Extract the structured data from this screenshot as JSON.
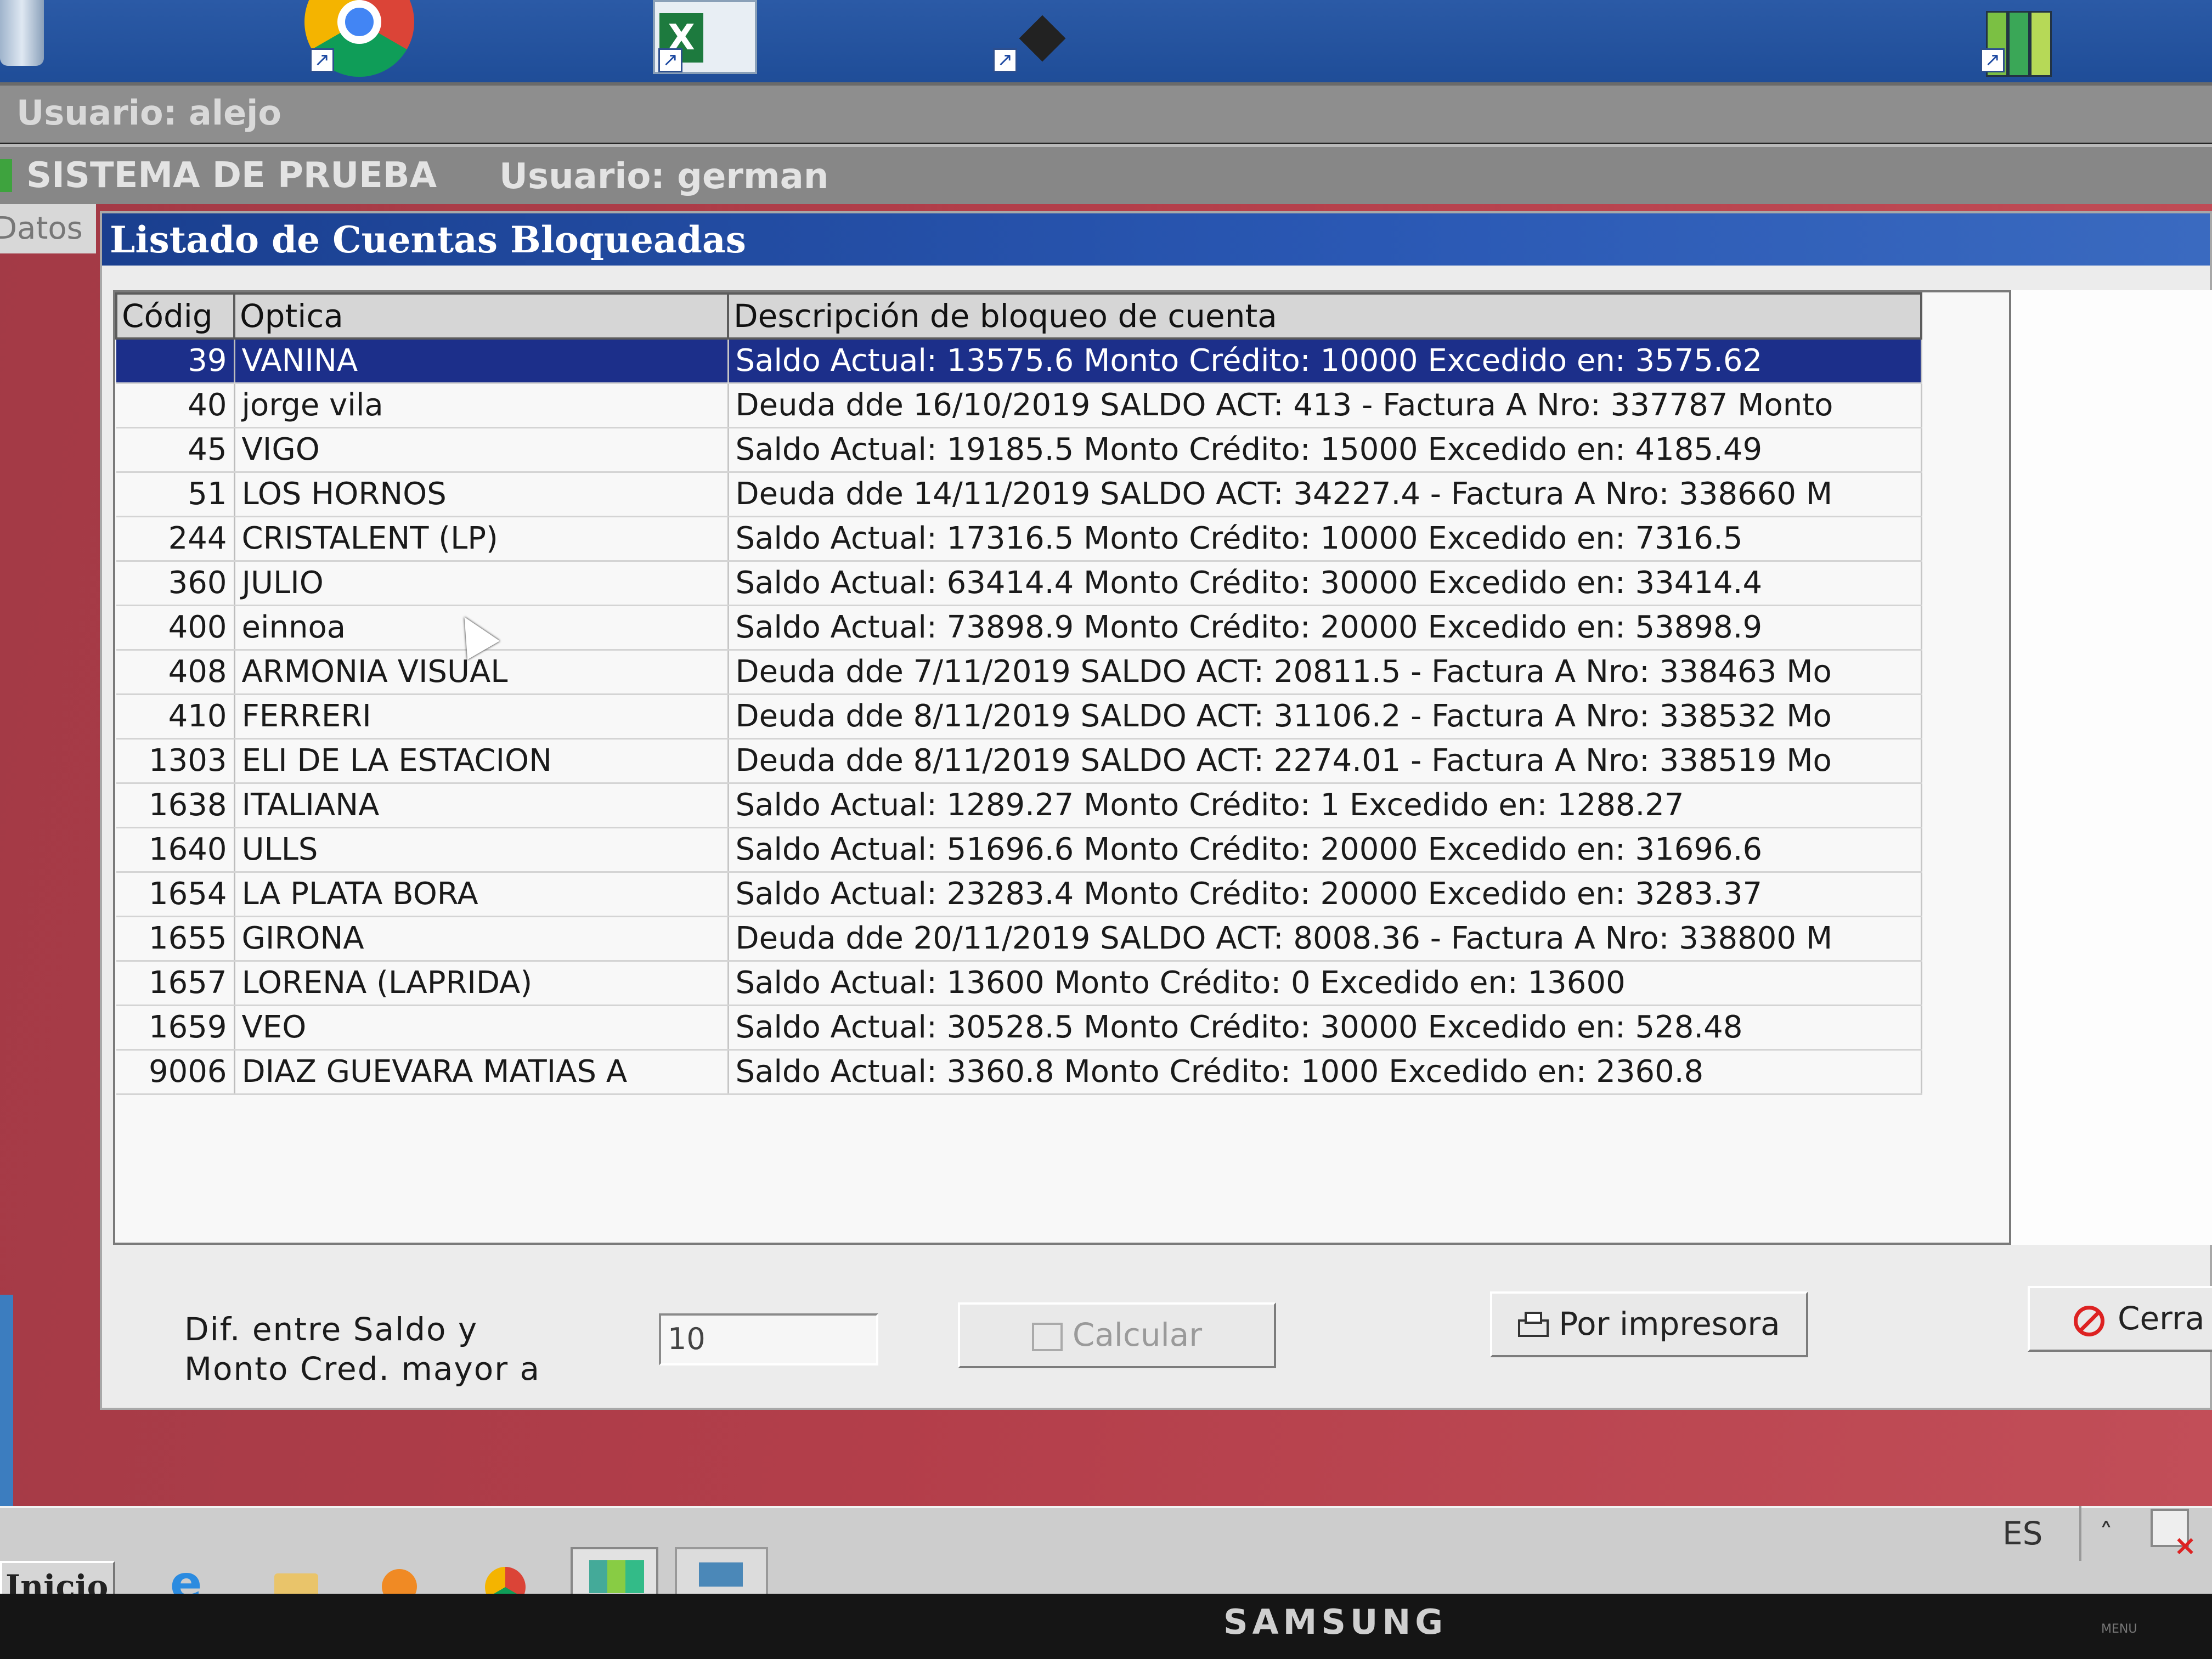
{
  "outer_window": {
    "user_label": "Usuario: alejo"
  },
  "app_window": {
    "system_name": "SISTEMA DE PRUEBA",
    "user_label": "Usuario: german",
    "side_tab": "Datos"
  },
  "dialog": {
    "title": "Listado de Cuentas Bloqueadas",
    "columns": [
      "Códig",
      "Optica",
      "Descripción de bloqueo de cuenta"
    ],
    "rows": [
      {
        "codigo": "39",
        "optica": "VANINA",
        "descripcion": "Saldo Actual: 13575.6    Monto Crédito: 10000    Excedido en: 3575.62",
        "selected": true
      },
      {
        "codigo": "40",
        "optica": "jorge vila",
        "descripcion": "Deuda dde 16/10/2019 SALDO ACT: 413 - Factura A Nro: 337787 Monto"
      },
      {
        "codigo": "45",
        "optica": "VIGO",
        "descripcion": "Saldo Actual: 19185.5    Monto Crédito: 15000    Excedido en: 4185.49"
      },
      {
        "codigo": "51",
        "optica": "LOS HORNOS",
        "descripcion": "Deuda dde 14/11/2019 SALDO ACT: 34227.4 - Factura A Nro: 338660 M"
      },
      {
        "codigo": "244",
        "optica": "CRISTALENT (LP)",
        "descripcion": "Saldo Actual: 17316.5    Monto Crédito: 10000    Excedido en: 7316.5"
      },
      {
        "codigo": "360",
        "optica": "JULIO",
        "descripcion": "Saldo Actual: 63414.4    Monto Crédito: 30000    Excedido en: 33414.4"
      },
      {
        "codigo": "400",
        "optica": "einnoa",
        "descripcion": "Saldo Actual: 73898.9    Monto Crédito: 20000    Excedido en: 53898.9"
      },
      {
        "codigo": "408",
        "optica": "ARMONIA VISUAL",
        "descripcion": "Deuda dde 7/11/2019 SALDO ACT: 20811.5 - Factura A Nro: 338463 Mo"
      },
      {
        "codigo": "410",
        "optica": "FERRERI",
        "descripcion": "Deuda dde 8/11/2019 SALDO ACT: 31106.2 - Factura A Nro: 338532 Mo"
      },
      {
        "codigo": "1303",
        "optica": "ELI DE LA ESTACION",
        "descripcion": "Deuda dde 8/11/2019 SALDO ACT: 2274.01 - Factura A Nro: 338519 Mo"
      },
      {
        "codigo": "1638",
        "optica": "ITALIANA",
        "descripcion": "Saldo Actual: 1289.27    Monto Crédito: 1    Excedido en: 1288.27"
      },
      {
        "codigo": "1640",
        "optica": "ULLS",
        "descripcion": "Saldo Actual: 51696.6    Monto Crédito: 20000    Excedido en: 31696.6"
      },
      {
        "codigo": "1654",
        "optica": "LA PLATA BORA",
        "descripcion": "Saldo Actual: 23283.4    Monto Crédito: 20000    Excedido en: 3283.37"
      },
      {
        "codigo": "1655",
        "optica": "GIRONA",
        "descripcion": "Deuda dde 20/11/2019 SALDO ACT: 8008.36 - Factura A Nro: 338800 M"
      },
      {
        "codigo": "1657",
        "optica": "LORENA (LAPRIDA)",
        "descripcion": "Saldo Actual: 13600    Monto Crédito: 0    Excedido en: 13600"
      },
      {
        "codigo": "1659",
        "optica": "VEO",
        "descripcion": "Saldo Actual: 30528.5    Monto Crédito: 30000    Excedido en: 528.48"
      },
      {
        "codigo": "9006",
        "optica": "DIAZ GUEVARA MATIAS A",
        "descripcion": "Saldo Actual: 3360.8    Monto Crédito: 1000    Excedido en: 2360.8"
      }
    ],
    "filter_label_line1": "Dif. entre Saldo y",
    "filter_label_line2": "Monto Cred. mayor a",
    "filter_value": "10",
    "calc_button": "Calcular",
    "print_button": "Por impresora",
    "close_button": "Cerra"
  },
  "taskbar": {
    "start_label": "Inicio",
    "language": "ES",
    "tray_arrow": "˄"
  },
  "monitor": {
    "brand": "SAMSUNG",
    "menu_label": "MENU"
  },
  "colors": {
    "selection": "#1c2f8a",
    "title_bar": "#1a3f8f",
    "app_background": "#b33e4a"
  }
}
